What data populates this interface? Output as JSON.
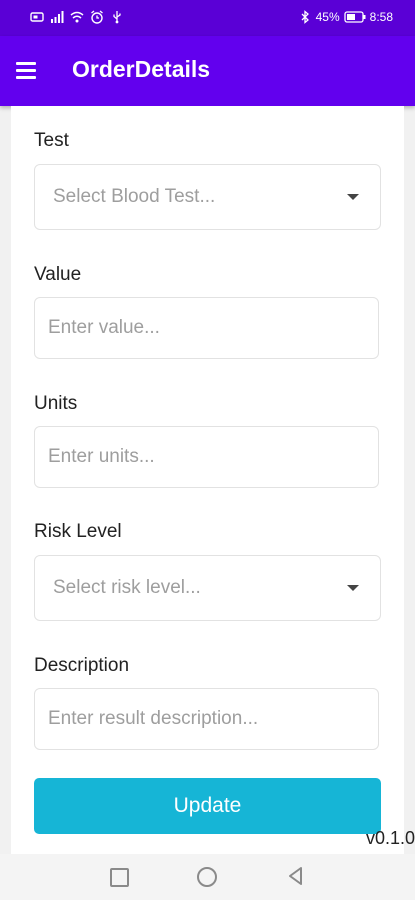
{
  "status_bar": {
    "battery": "45%",
    "time": "8:58",
    "left_icons": [
      "sim-icon",
      "signal-icon",
      "wifi-icon",
      "alarm-icon",
      "usb-icon"
    ],
    "right_icons": [
      "bluetooth-icon",
      "battery-icon"
    ]
  },
  "app_bar": {
    "title": "OrderDetails"
  },
  "form": {
    "test": {
      "label": "Test",
      "placeholder": "Select Blood Test..."
    },
    "value": {
      "label": "Value",
      "placeholder": "Enter value..."
    },
    "units": {
      "label": "Units",
      "placeholder": "Enter units..."
    },
    "risk_level": {
      "label": "Risk Level",
      "placeholder": "Select risk level..."
    },
    "description": {
      "label": "Description",
      "placeholder": "Enter result description..."
    },
    "update_label": "Update"
  },
  "footer": {
    "version": "v0.1.0"
  },
  "colors": {
    "app_bar": "#6200ee",
    "status_bar": "#5a00d6",
    "button": "#16b5d6"
  }
}
